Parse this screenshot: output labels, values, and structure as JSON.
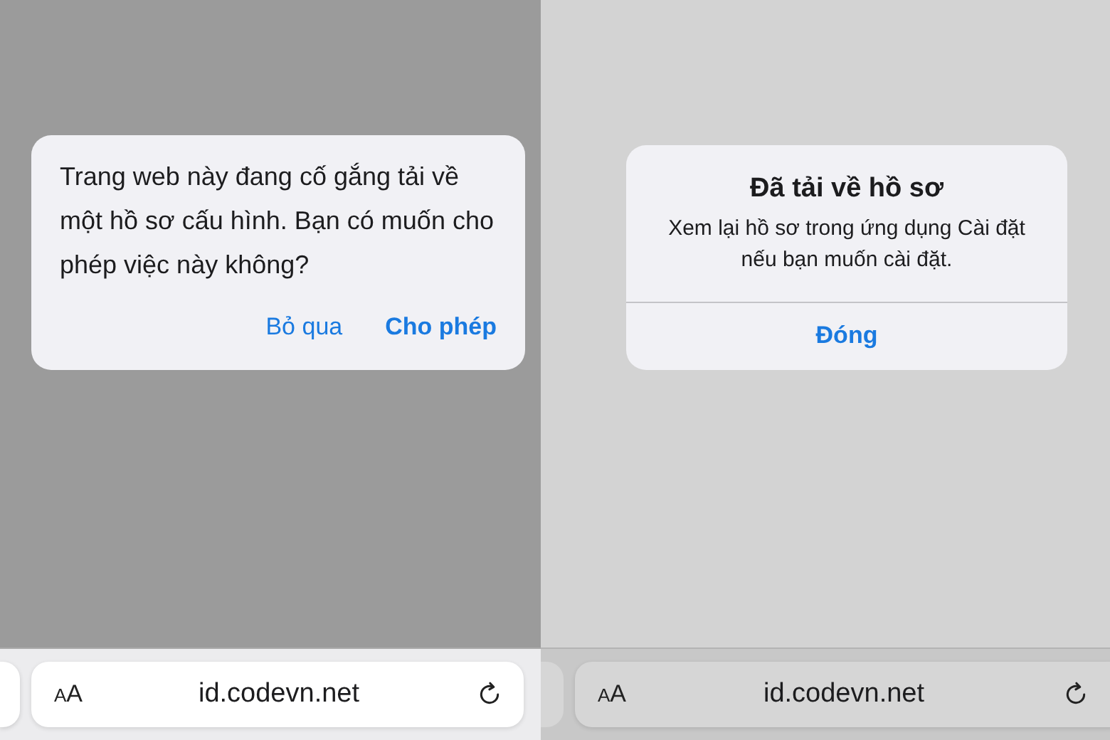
{
  "screens": [
    {
      "kind": "prompt",
      "dialog": {
        "message": "Trang web này đang cố gắng tải về một hồ sơ cấu hình. Bạn có muốn cho phép việc này không?",
        "buttons": [
          {
            "label": "Bỏ qua",
            "primary": false
          },
          {
            "label": "Cho phép",
            "primary": true
          }
        ]
      },
      "address_bar": {
        "text_size_button": "AA",
        "url": "id.codevn.net"
      }
    },
    {
      "kind": "notice",
      "dialog": {
        "title": "Đã tải về hồ sơ",
        "message": "Xem lại hồ sơ trong ứng dụng Cài đặt nếu bạn muốn cài đặt.",
        "buttons": [
          {
            "label": "Đóng",
            "primary": true
          }
        ]
      },
      "address_bar": {
        "text_size_button": "AA",
        "url": "id.codevn.net"
      }
    }
  ]
}
